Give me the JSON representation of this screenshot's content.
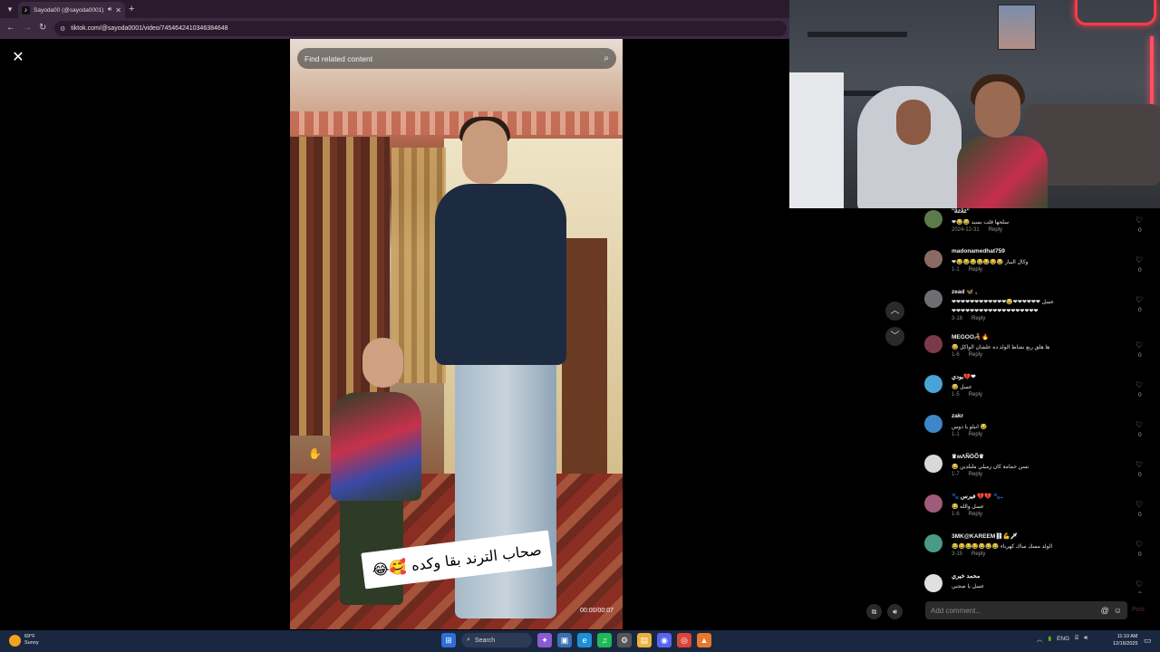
{
  "browser": {
    "tab_title": "Sayoda00 (@sayoda0001) |",
    "url": "tiktok.com/@sayoda0001/video/7454642410346384648"
  },
  "video": {
    "search_placeholder": "Find related content",
    "caption": "صحاب الترند بقا وكده 🥰😂",
    "timecode": "00:00/00:07"
  },
  "comments": [
    {
      "user": "\"ãzãz\"",
      "text": "❤😂😂 سلحها قلت بسيد",
      "date": "2024-12-31",
      "reply": "Reply",
      "likes": "0",
      "avatar_color": "#5d7a4a"
    },
    {
      "user": "madonamedhat759",
      "text": "❤😂😂😂😂😂😂😂 وكال البيار",
      "date": "1-1",
      "reply": "Reply",
      "likes": "0",
      "avatar_color": "#8a6a62"
    },
    {
      "user": "zead 🦋 ,",
      "text": "❤❤❤❤❤❤❤❤❤❤❤❤😂❤❤❤❤❤❤ عسل",
      "text2": "❤❤❤❤❤❤❤❤❤❤❤❤❤❤❤❤❤❤❤",
      "date": "3-18",
      "reply": "Reply",
      "likes": "0",
      "avatar_color": "#6e6e72"
    },
    {
      "user": "MEGOO🦂🔥",
      "text": "😂 ها هلق ربع نشاط الولد ده علشان الواكل",
      "date": "1-6",
      "reply": "Reply",
      "likes": "0",
      "avatar_color": "#7b3a4a"
    },
    {
      "user": "بودي💔❤",
      "text": "😂 عسل",
      "date": "1-5",
      "reply": "Reply",
      "likes": "0",
      "avatar_color": "#4aa3d6"
    },
    {
      "user": "zakr",
      "text": "انبلو يا دوس 😂",
      "date": "1-1",
      "reply": "Reply",
      "likes": "0",
      "avatar_color": "#3e86c7"
    },
    {
      "user": "♛ʍΛÑÖÕ♛",
      "text": "😂 نسن حمامة كان زميلي ملبلدين",
      "date": "1-7",
      "reply": "Reply",
      "likes": "0",
      "avatar_color": "#d9d9d9"
    },
    {
      "user": "🐾 فيرس 💔💔 🐾.",
      "text": "😂 عسل والله",
      "date": "1-6",
      "reply": "Reply",
      "likes": "0",
      "avatar_color": "#a05a7a"
    },
    {
      "user": "3MK@KAREEM⛓💪🗡",
      "text": "😂😂😂😂😂😂😂 الولد مسك ساك كهرباء",
      "date": "3-15",
      "reply": "Reply",
      "likes": "0",
      "avatar_color": "#4a9a8a"
    },
    {
      "user": "محمد خيري",
      "text": "عسل يا صحبي",
      "date": "",
      "reply": "",
      "likes": "0",
      "avatar_color": "#e0e0e0"
    }
  ],
  "comment_input": {
    "placeholder": "Add comment...",
    "post_label": "Post"
  },
  "taskbar": {
    "temp": "69°F",
    "condition": "Sunny",
    "search_label": "Search",
    "lang": "ENG",
    "time": "11:10 AM",
    "date": "12/16/2025"
  }
}
